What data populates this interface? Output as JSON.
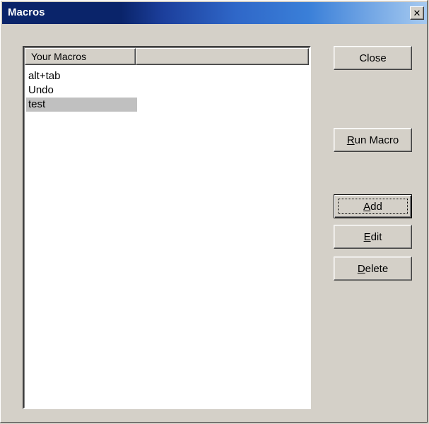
{
  "window": {
    "title": "Macros",
    "close_glyph": "✕"
  },
  "listview": {
    "columns": [
      {
        "label": "Your Macros"
      },
      {
        "label": ""
      }
    ],
    "items": [
      {
        "label": "alt+tab"
      },
      {
        "label": "Undo"
      },
      {
        "label": "test"
      }
    ],
    "selected": "test"
  },
  "buttons": {
    "close": {
      "label": "Close"
    },
    "run_macro": {
      "mnemonic": "R",
      "rest": "un Macro"
    },
    "add": {
      "mnemonic": "A",
      "rest": "dd"
    },
    "edit": {
      "mnemonic": "E",
      "rest": "dit"
    },
    "delete": {
      "mnemonic": "D",
      "rest": "elete"
    }
  },
  "colors": {
    "titlebar_start": "#0a246a",
    "titlebar_end": "#a6caf0",
    "face": "#d4d0c8",
    "selection": "#c0c0c0"
  }
}
